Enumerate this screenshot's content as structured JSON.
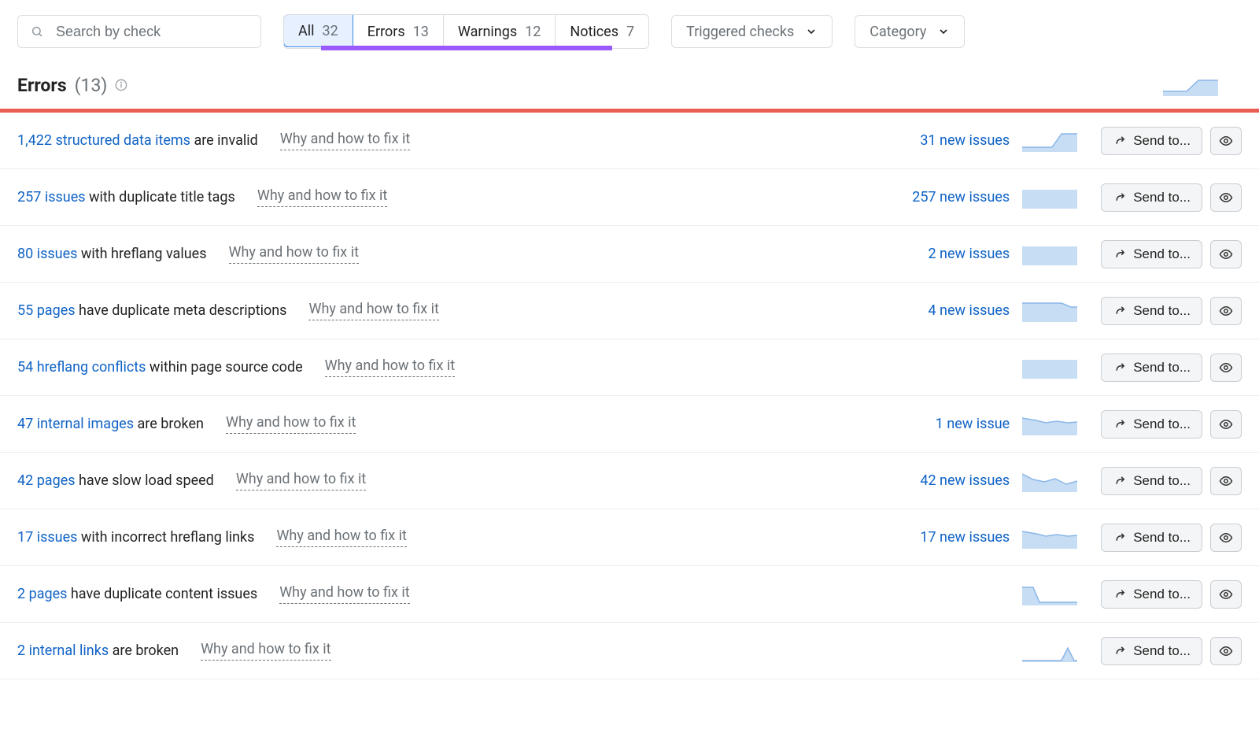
{
  "search": {
    "placeholder": "Search by check"
  },
  "tabs": [
    {
      "label": "All",
      "count": "32",
      "active": true
    },
    {
      "label": "Errors",
      "count": "13",
      "active": false
    },
    {
      "label": "Warnings",
      "count": "12",
      "active": false
    },
    {
      "label": "Notices",
      "count": "7",
      "active": false
    }
  ],
  "dropdowns": {
    "triggered": "Triggered checks",
    "category": "Category"
  },
  "section": {
    "title": "Errors",
    "count_text": "(13)"
  },
  "common": {
    "why": "Why and how to fix it",
    "send": "Send to..."
  },
  "issues": [
    {
      "link": "1,422 structured data items",
      "rest": " are invalid",
      "new": "31 new issues",
      "spark": "step-up"
    },
    {
      "link": "257 issues",
      "rest": " with duplicate title tags",
      "new": "257 new issues",
      "spark": "flat"
    },
    {
      "link": "80 issues",
      "rest": " with hreflang values",
      "new": "2 new issues",
      "spark": "flat"
    },
    {
      "link": "55 pages",
      "rest": " have duplicate meta descriptions",
      "new": "4 new issues",
      "spark": "flat-dip"
    },
    {
      "link": "54 hreflang conflicts",
      "rest": " within page source code",
      "new": "",
      "spark": "flat"
    },
    {
      "link": "47 internal images",
      "rest": " are broken",
      "new": "1 new issue",
      "spark": "wavy"
    },
    {
      "link": "42 pages",
      "rest": " have slow load speed",
      "new": "42 new issues",
      "spark": "wavy2"
    },
    {
      "link": "17 issues",
      "rest": " with incorrect hreflang links",
      "new": "17 new issues",
      "spark": "wavy"
    },
    {
      "link": "2 pages",
      "rest": " have duplicate content issues",
      "new": "",
      "spark": "drop"
    },
    {
      "link": "2 internal links",
      "rest": " are broken",
      "new": "",
      "spark": "valley"
    }
  ]
}
